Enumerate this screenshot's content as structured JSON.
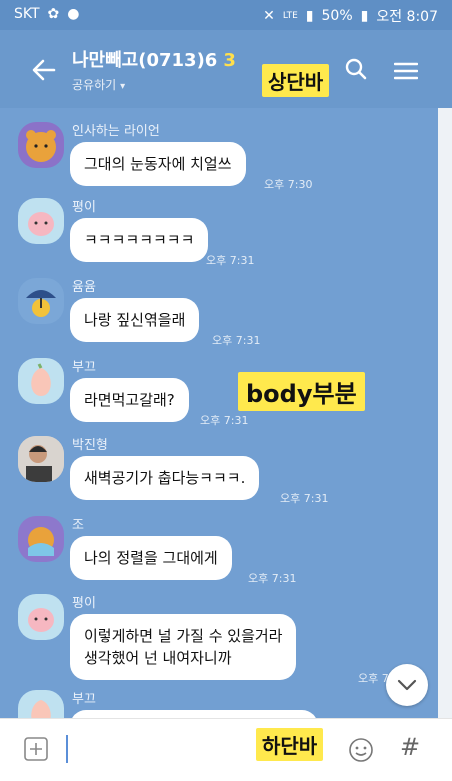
{
  "status_bar": {
    "carrier": "SKT",
    "battery": "50%",
    "time": "오전 8:07",
    "network": "LTE"
  },
  "header": {
    "title": "나만빼고(0713)6",
    "member_count": "3",
    "subtitle": "공유하기",
    "annotation": "상단바"
  },
  "body_annotation": "body부분",
  "bottom_annotation": "하단바",
  "messages": [
    {
      "sender": "인사하는 라이언",
      "text": "그대의 눈동자에 치얼쓰",
      "time": "오후 7:30"
    },
    {
      "sender": "평이",
      "text": "ㅋㅋㅋㅋㅋㅋㅋㅋ",
      "time": "오후 7:31"
    },
    {
      "sender": "윰윰",
      "text": "나랑 짚신엮을래",
      "time": "오후 7:31"
    },
    {
      "sender": "부끄",
      "text": "라면먹고갈래?",
      "time": "오후 7:31"
    },
    {
      "sender": "박진형",
      "text": "새벽공기가 춥다능ㅋㅋㅋ.",
      "time": "오후 7:31"
    },
    {
      "sender": "조",
      "text": "나의 정렬을 그대에게",
      "time": "오후 7:31"
    },
    {
      "sender": "평이",
      "text_line1": "이렇게하면 널 가질 수 있을거라",
      "text_line2": "생각했어 넌 내여자니까",
      "time": "오후 7:3"
    },
    {
      "sender": "부끄"
    }
  ],
  "icons": {
    "back": "back-arrow-icon",
    "search": "search-icon",
    "menu": "menu-icon",
    "plus": "plus-icon",
    "emoji": "emoji-icon",
    "hash": "hash-icon",
    "scroll_down": "chevron-down-icon"
  },
  "colors": {
    "header": "#6b99cc",
    "chat_background": "#729fd2",
    "annotation": "#ffe94d",
    "member_count": "#ffdf4c"
  }
}
